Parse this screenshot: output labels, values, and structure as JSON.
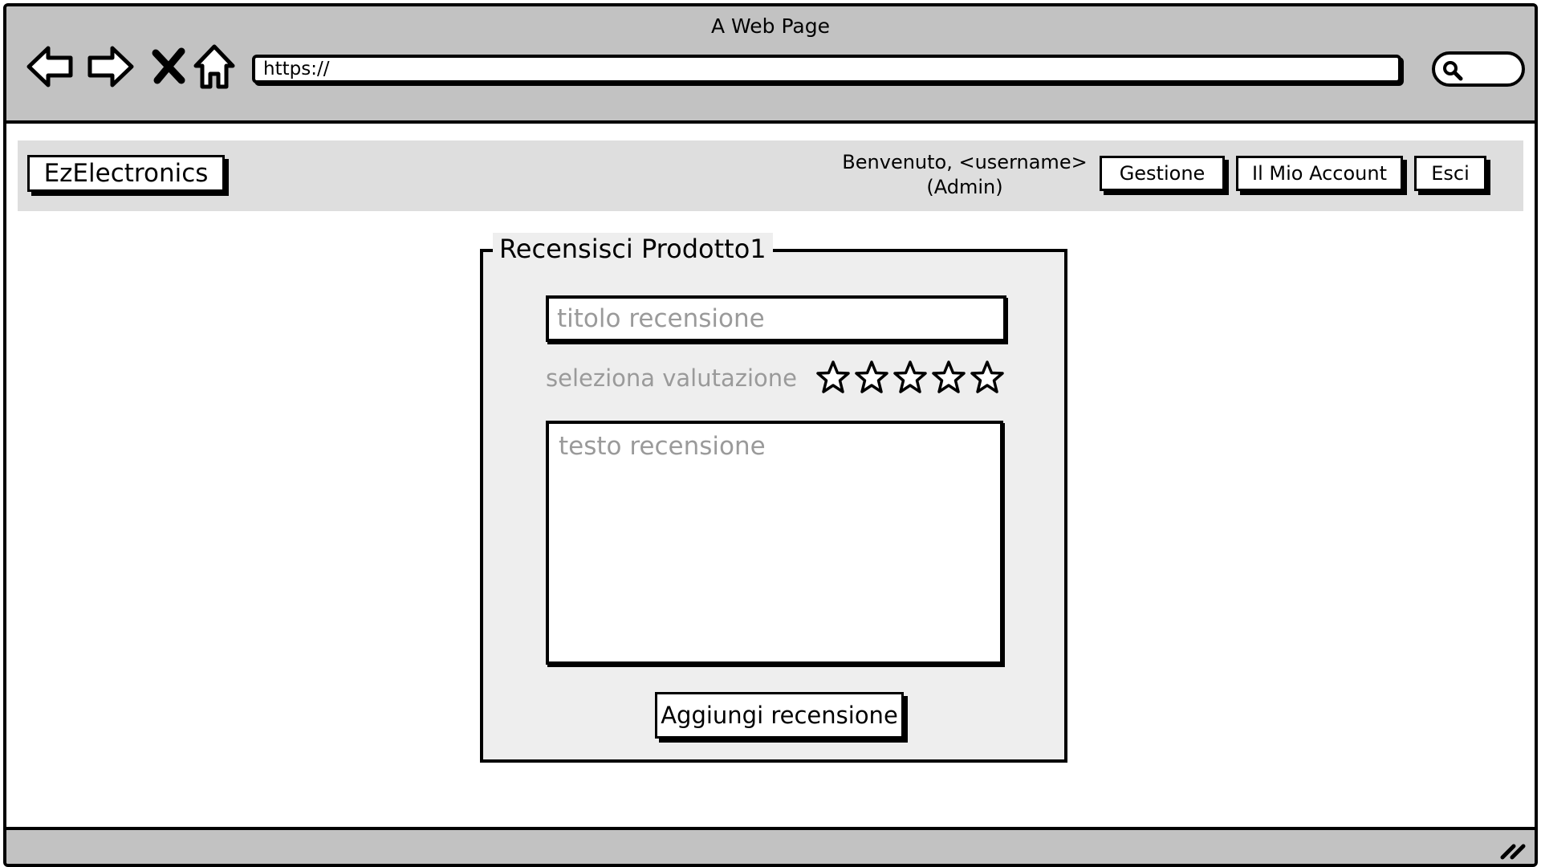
{
  "window": {
    "title": "A Web Page"
  },
  "browser": {
    "url": "https://"
  },
  "navbar": {
    "brand": "EzElectronics",
    "welcome_line1": "Benvenuto, <username>",
    "welcome_line2": "(Admin)",
    "buttons": {
      "gestione": "Gestione",
      "account": "Il Mio Account",
      "esci": "Esci"
    }
  },
  "review_form": {
    "legend": "Recensisci Prodotto1",
    "title_placeholder": "titolo recensione",
    "rating_label": "seleziona valutazione",
    "rating_value": 0,
    "rating_max": 5,
    "text_placeholder": "testo recensione",
    "submit_label": "Aggiungi recensione"
  },
  "colors": {
    "chrome": "#c2c2c2",
    "navbar_bg": "#dedede",
    "panel_bg": "#eeeeee",
    "placeholder": "#9a9a9a"
  }
}
